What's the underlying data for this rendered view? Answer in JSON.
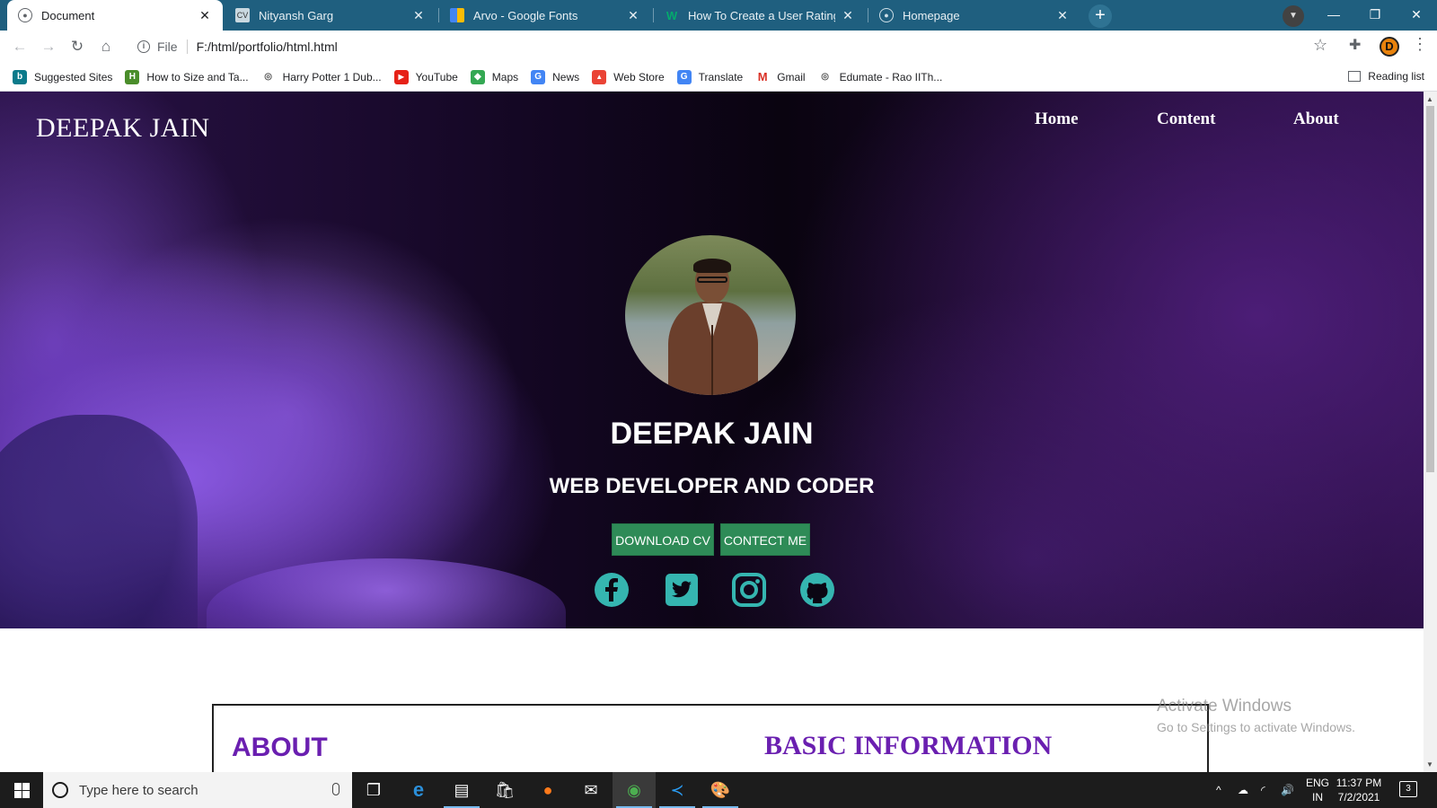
{
  "browser": {
    "tabs": [
      {
        "title": "Document",
        "favicon": "globe-icon",
        "active": true
      },
      {
        "title": "Nityansh Garg",
        "favicon": "cv-icon",
        "badge": "CV",
        "active": false
      },
      {
        "title": "Arvo - Google Fonts",
        "favicon": "google-fonts-icon",
        "active": false
      },
      {
        "title": "How To Create a User Rating Sco",
        "favicon": "w3schools-icon",
        "badge": "W",
        "active": false
      },
      {
        "title": "Homepage",
        "favicon": "globe-icon",
        "active": false
      }
    ],
    "new_tab_label": "+",
    "address": {
      "scheme": "File",
      "url": "F:/html/portfolio/html.html"
    },
    "profile_initial": "D",
    "bookmarks": [
      {
        "label": "Suggested Sites",
        "icon": "bing-icon",
        "color": "#0b7a8a",
        "glyph": "b"
      },
      {
        "label": "How to Size and Ta...",
        "icon": "h-icon",
        "color": "#4a8d2a",
        "glyph": "H"
      },
      {
        "label": "Harry Potter 1 Dub...",
        "icon": "globe-icon",
        "color": "#555555",
        "glyph": "◎"
      },
      {
        "label": "YouTube",
        "icon": "youtube-icon",
        "color": "#e62117",
        "glyph": "▶"
      },
      {
        "label": "Maps",
        "icon": "maps-icon",
        "color": "#34a853",
        "glyph": "◆"
      },
      {
        "label": "News",
        "icon": "news-icon",
        "color": "#4285f4",
        "glyph": "G"
      },
      {
        "label": "Web Store",
        "icon": "webstore-icon",
        "color": "#ea4335",
        "glyph": "▲"
      },
      {
        "label": "Translate",
        "icon": "translate-icon",
        "color": "#4285f4",
        "glyph": "G"
      },
      {
        "label": "Gmail",
        "icon": "gmail-icon",
        "color": "#d93025",
        "glyph": "M"
      },
      {
        "label": "Edumate - Rao IITh...",
        "icon": "globe-icon",
        "color": "#555555",
        "glyph": "◎"
      }
    ],
    "reading_list": "Reading list"
  },
  "page": {
    "brand": "DEEPAK JAIN",
    "nav": [
      "Home",
      "Content",
      "About"
    ],
    "hero": {
      "name": "DEEPAK JAIN",
      "role": "WEB DEVELOPER AND CODER",
      "buttons": {
        "download": "DOWNLOAD CV",
        "contact": "CONTECT ME"
      },
      "social_icons": [
        "facebook-icon",
        "twitter-icon",
        "instagram-icon",
        "github-icon"
      ],
      "social_color": "#35b5b0"
    },
    "sections": {
      "about": "ABOUT",
      "basic": "BASIC INFORMATION"
    },
    "accent_color": "#6a1fb0",
    "button_color": "#2e8b57"
  },
  "watermark": {
    "line1": "Activate Windows",
    "line2": "Go to Settings to activate Windows."
  },
  "taskbar": {
    "search_placeholder": "Type here to search",
    "language": {
      "line1": "ENG",
      "line2": "IN"
    },
    "time": "11:37 PM",
    "date": "7/2/2021",
    "notification_count": "3"
  }
}
